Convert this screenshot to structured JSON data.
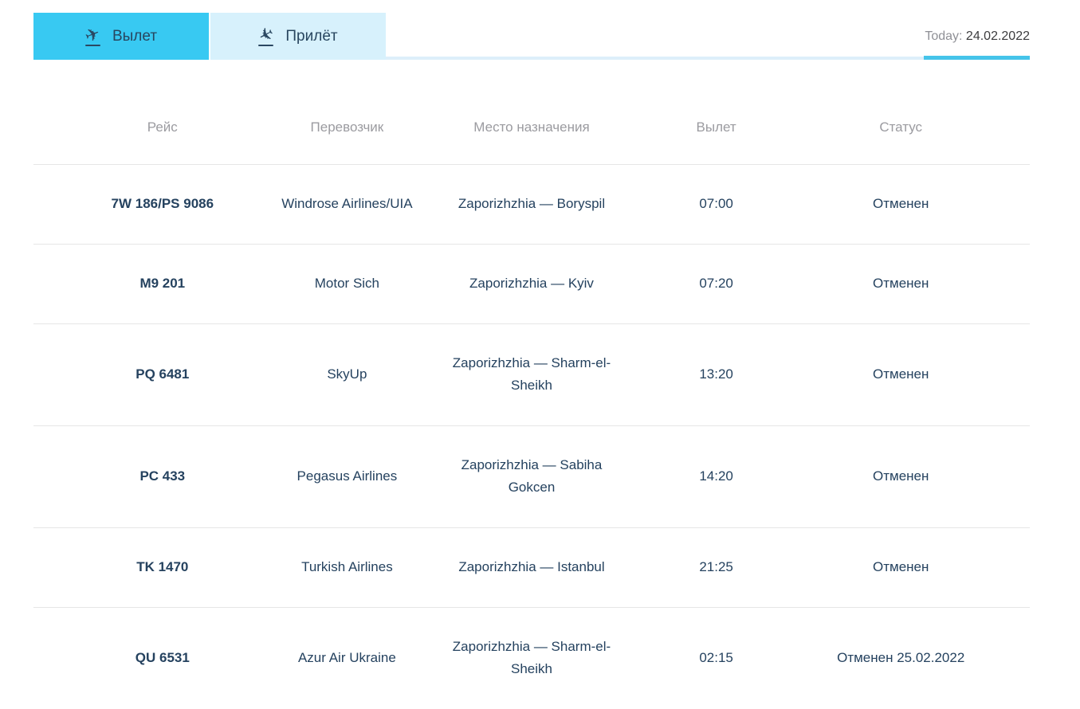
{
  "colors": {
    "tab_active_bg": "#38c9f2",
    "tab_inactive_bg": "#d7f1fc",
    "underline_track": "#ddeffa",
    "underline_accent": "#45c4ea",
    "text_navy": "#25425f",
    "text_gray": "#9b9ba0",
    "divider": "#e6e6e6"
  },
  "tabs": [
    {
      "label": "Вылет",
      "icon": "plane-takeoff-icon",
      "active": true
    },
    {
      "label": "Прилёт",
      "icon": "plane-landing-icon",
      "active": false
    }
  ],
  "today": {
    "label": "Today:",
    "date": "24.02.2022"
  },
  "table": {
    "headers": [
      "Рейс",
      "Перевозчик",
      "Место назначения",
      "Вылет",
      "Статус"
    ],
    "rows": [
      {
        "flight": "7W 186/PS 9086",
        "carrier": "Windrose Airlines/UIA",
        "destination": "Zaporizhzhia — Boryspil",
        "departure": "07:00",
        "status": "Отменен"
      },
      {
        "flight": "M9 201",
        "carrier": "Motor Sich",
        "destination": "Zaporizhzhia — Kyiv",
        "departure": "07:20",
        "status": "Отменен"
      },
      {
        "flight": "PQ 6481",
        "carrier": "SkyUp",
        "destination": "Zaporizhzhia — Sharm-el-Sheikh",
        "departure": "13:20",
        "status": "Отменен"
      },
      {
        "flight": "PC 433",
        "carrier": "Pegasus Airlines",
        "destination": "Zaporizhzhia — Sabiha Gokcen",
        "departure": "14:20",
        "status": "Отменен"
      },
      {
        "flight": "TK 1470",
        "carrier": "Turkish Airlines",
        "destination": "Zaporizhzhia — Istanbul",
        "departure": "21:25",
        "status": "Отменен"
      },
      {
        "flight": "QU 6531",
        "carrier": "Azur Air Ukraine",
        "destination": "Zaporizhzhia — Sharm-el-Sheikh",
        "departure": "02:15",
        "status": "Отменен 25.02.2022"
      }
    ]
  }
}
